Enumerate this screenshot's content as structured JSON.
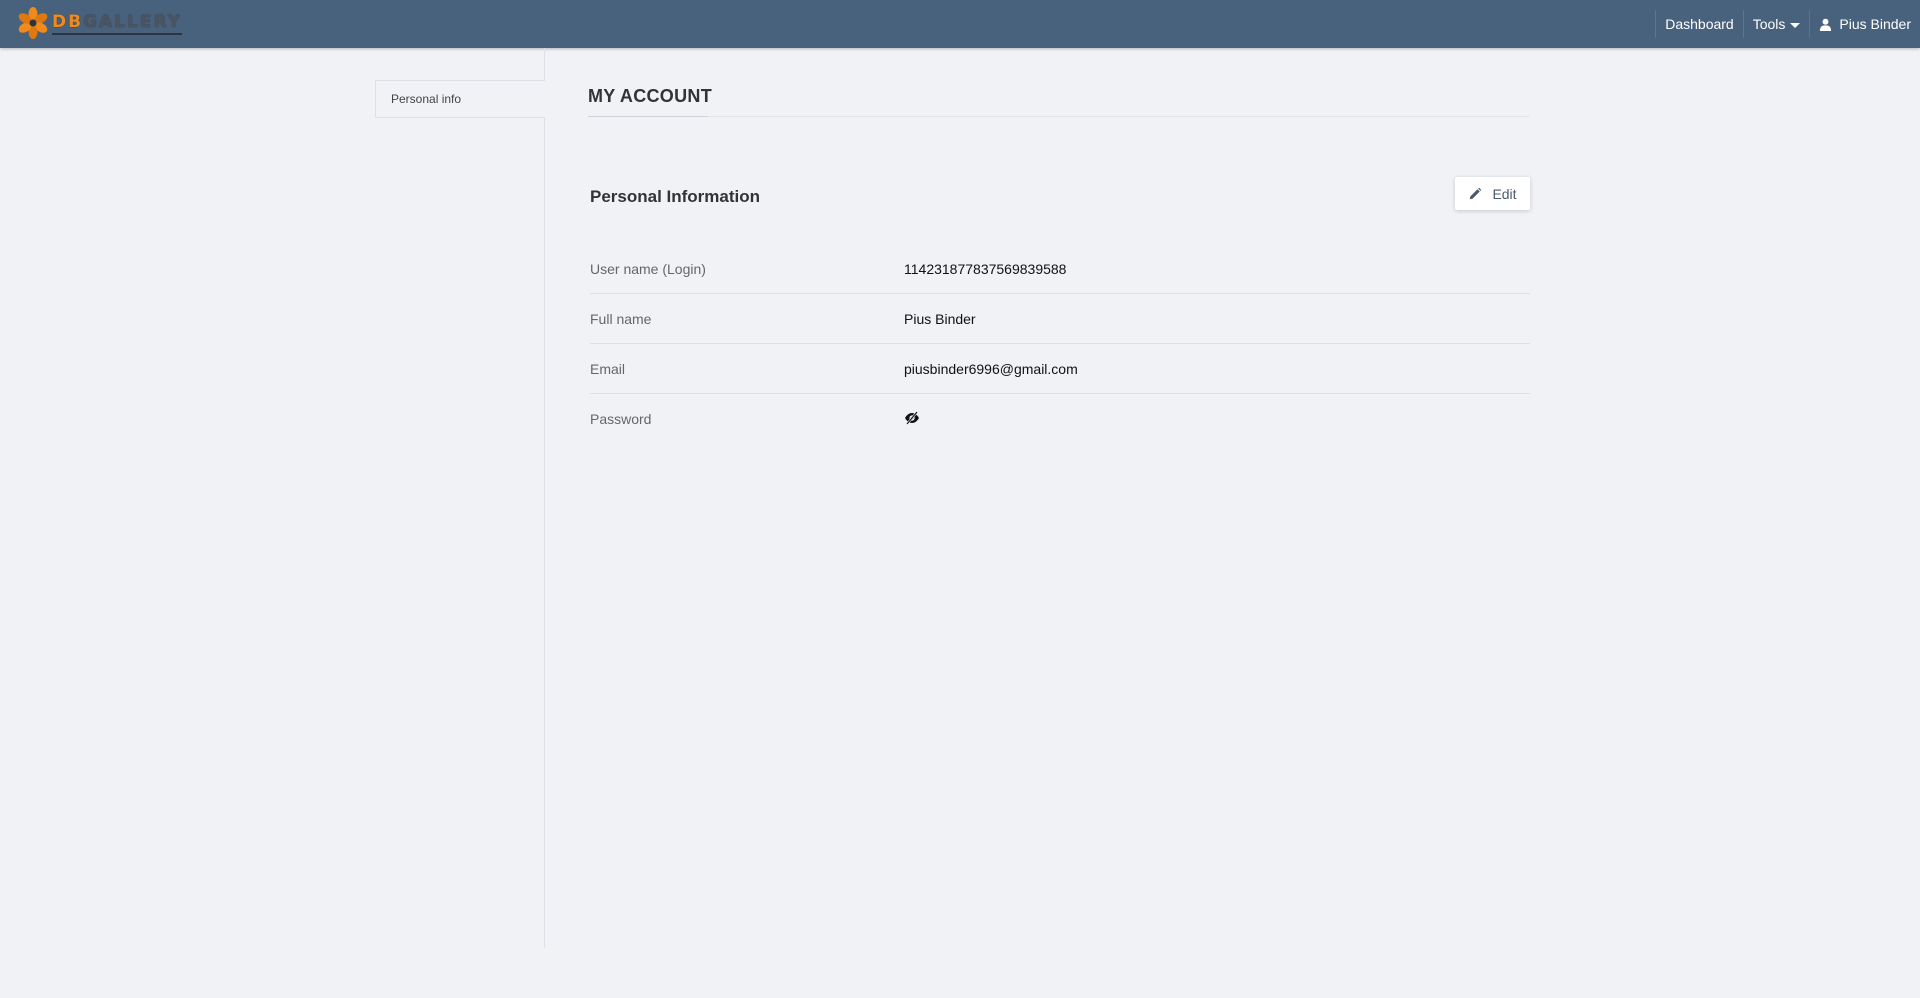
{
  "brand": {
    "name_part1": "DB",
    "name_part2": "GALLERY",
    "logo_icon": "orange-flower-icon",
    "accent_color": "#f08a1c"
  },
  "navbar": {
    "background_color": "#48617c",
    "items": [
      {
        "label": "Dashboard"
      },
      {
        "label": "Tools",
        "icon": "caret-down-icon"
      },
      {
        "label": "Pius Binder",
        "icon": "user-icon"
      }
    ]
  },
  "sidebar": {
    "items": [
      {
        "label": "Personal info",
        "active": true
      }
    ]
  },
  "main": {
    "page_title": "MY ACCOUNT",
    "section_title": "Personal Information",
    "edit_button": {
      "label": "Edit",
      "icon": "pencil-icon"
    },
    "fields": [
      {
        "label": "User name (Login)",
        "value": "114231877837569839588"
      },
      {
        "label": "Full name",
        "value": "Pius Binder"
      },
      {
        "label": "Email",
        "value": "piusbinder6996@gmail.com"
      },
      {
        "label": "Password",
        "icon": "eye-slash-icon"
      }
    ]
  }
}
